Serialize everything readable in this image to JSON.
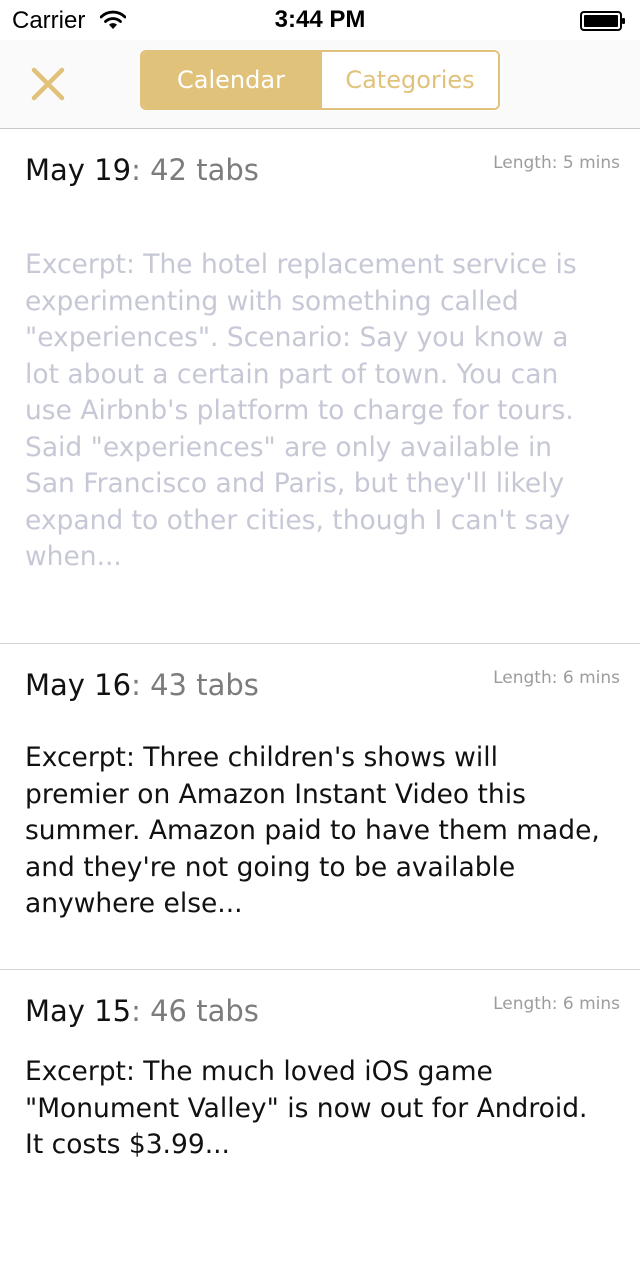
{
  "status_bar": {
    "carrier": "Carrier",
    "time": "3:44 PM",
    "icons": [
      "wifi-icon",
      "battery-icon"
    ]
  },
  "nav_bar": {
    "close_icon": "close-icon",
    "segments": [
      {
        "label": "Calendar",
        "selected": true
      },
      {
        "label": "Categories",
        "selected": false
      }
    ]
  },
  "colors": {
    "accent": "#e0c27a",
    "faded_text": "#c6c8d6",
    "tab_count": "#7c7c7c",
    "meta_text": "#9c9c9c",
    "separator": "#d6d6d6"
  },
  "entries": [
    {
      "date": "May 19",
      "separator": ":",
      "tabs": "42 tabs",
      "length": "Length: 5 mins",
      "excerpt": "Excerpt: The hotel replacement service is experimenting with something called \"experiences\". Scenario: Say you know a lot about a certain part of town. You can use Airbnb's platform to charge for tours. Said \"experiences\" are only available in San Francisco and Paris, but they'll likely expand to other cities, though I can't say when...",
      "excerpt_faded": true
    },
    {
      "date": "May 16",
      "separator": ":",
      "tabs": "43 tabs",
      "length": "Length: 6 mins",
      "excerpt": "Excerpt: Three children's shows will premier on Amazon Instant Video this summer. Amazon paid to have them made, and they're not going to be available anywhere else...",
      "excerpt_faded": false
    },
    {
      "date": "May 15",
      "separator": ":",
      "tabs": "46 tabs",
      "length": "Length: 6 mins",
      "excerpt": "Excerpt: The much loved iOS game \"Monument Valley\" is now out for Android. It costs $3.99...",
      "excerpt_faded": false
    }
  ]
}
